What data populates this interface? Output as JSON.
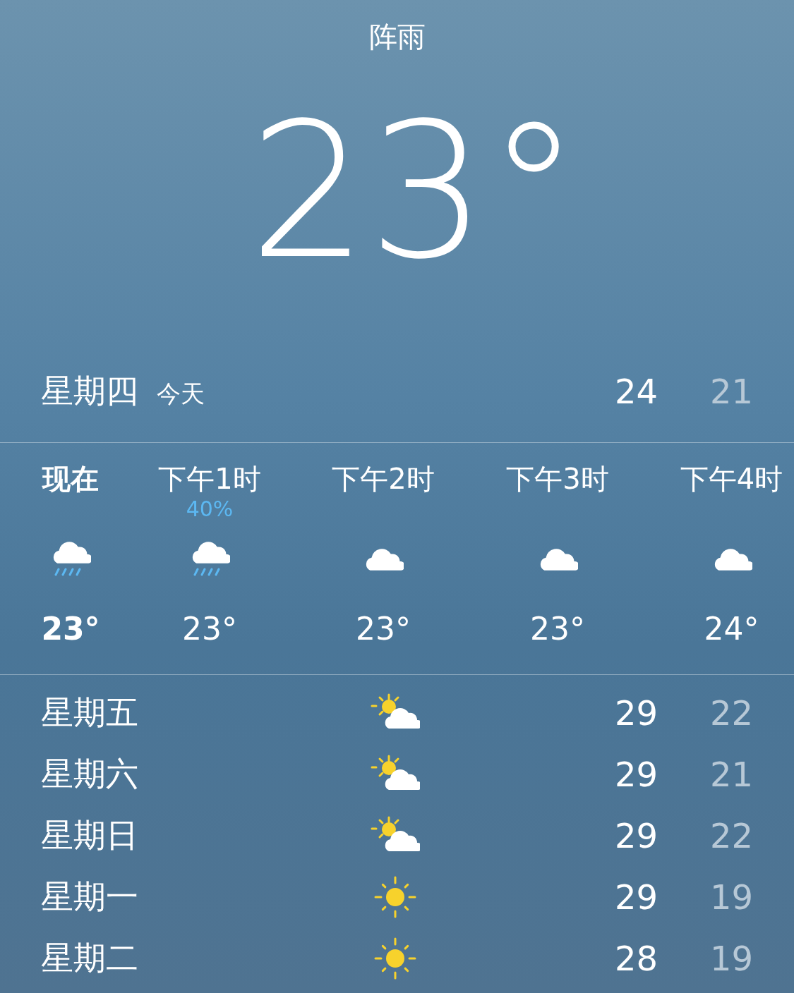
{
  "current": {
    "condition": "阵雨",
    "temperature": "23°"
  },
  "today": {
    "day": "星期四",
    "label": "今天",
    "high": "24",
    "low": "21"
  },
  "hourly": [
    {
      "time": "现在",
      "current": true,
      "kind": "rain",
      "temp": "23°"
    },
    {
      "time": "下午1时",
      "current": false,
      "kind": "rain",
      "precip": "40%",
      "temp": "23°"
    },
    {
      "time": "下午2时",
      "current": false,
      "kind": "cloud",
      "temp": "23°"
    },
    {
      "time": "下午3时",
      "current": false,
      "kind": "cloud",
      "temp": "23°"
    },
    {
      "time": "下午4时",
      "current": false,
      "kind": "cloud",
      "temp": "24°"
    }
  ],
  "daily": [
    {
      "day": "星期五",
      "kind": "partly_sunny",
      "high": "29",
      "low": "22"
    },
    {
      "day": "星期六",
      "kind": "partly_sunny",
      "high": "29",
      "low": "21"
    },
    {
      "day": "星期日",
      "kind": "partly_sunny",
      "high": "29",
      "low": "22"
    },
    {
      "day": "星期一",
      "kind": "sunny",
      "high": "29",
      "low": "19"
    },
    {
      "day": "星期二",
      "kind": "sunny",
      "high": "28",
      "low": "19"
    }
  ]
}
